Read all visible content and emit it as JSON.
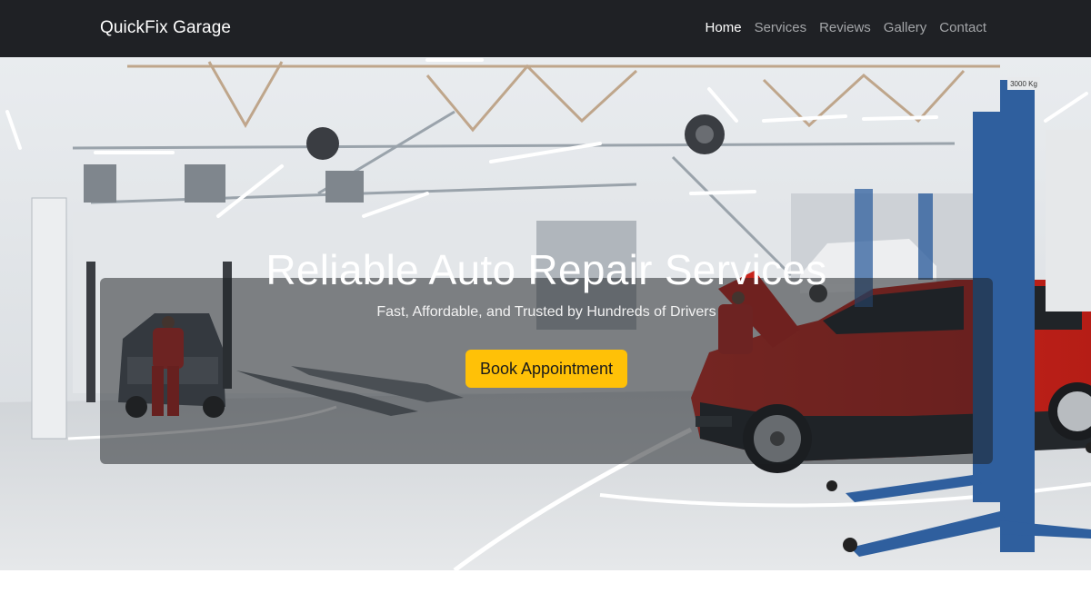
{
  "navbar": {
    "brand": "QuickFix Garage",
    "links": [
      {
        "label": "Home",
        "active": true
      },
      {
        "label": "Services",
        "active": false
      },
      {
        "label": "Reviews",
        "active": false
      },
      {
        "label": "Gallery",
        "active": false
      },
      {
        "label": "Contact",
        "active": false
      }
    ]
  },
  "hero": {
    "title": "Reliable Auto Repair Services",
    "subtitle": "Fast, Affordable, and Trusted by Hundreds of Drivers",
    "cta_label": "Book Appointment",
    "lift_capacity_label": "3000 Kg"
  },
  "colors": {
    "navbar_bg": "#1f2125",
    "cta_bg": "#ffc107",
    "car_red": "#c8231b",
    "lift_blue": "#2f5f9e"
  }
}
